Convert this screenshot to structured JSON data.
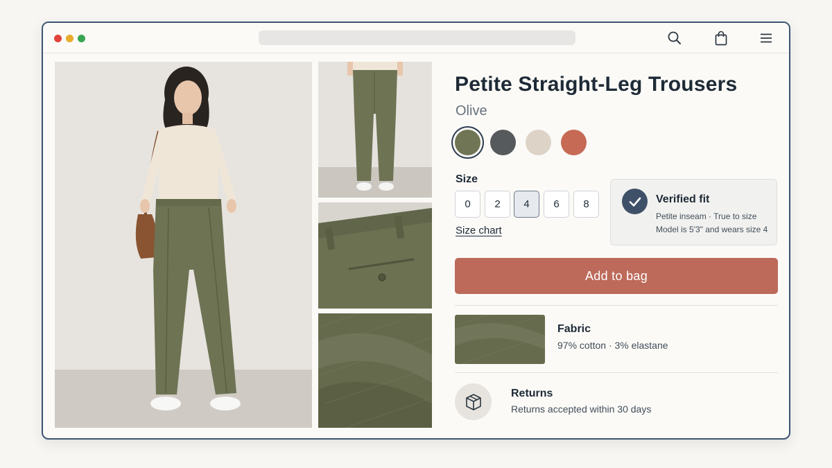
{
  "browser": {
    "controls": [
      "close",
      "minimize",
      "maximize"
    ],
    "icons": [
      "search-icon",
      "shopping-bag-icon",
      "menu-icon"
    ]
  },
  "gallery": {
    "main_image": "Model wearing olive straight-leg trousers and cream sweater",
    "thumbnails": [
      "Back view of trousers",
      "Back pocket detail",
      "Fabric close-up"
    ]
  },
  "product": {
    "title": "Petite Straight-Leg Trousers",
    "color_name": "Olive",
    "swatches": [
      {
        "name": "Olive",
        "hex": "#6f7555",
        "selected": true
      },
      {
        "name": "Charcoal",
        "hex": "#575a5c",
        "selected": false
      },
      {
        "name": "Stone",
        "hex": "#ddd3c7",
        "selected": false
      },
      {
        "name": "Terracotta",
        "hex": "#c66a55",
        "selected": false
      }
    ],
    "size_label": "Size",
    "sizes": [
      "0",
      "2",
      "4",
      "6",
      "8"
    ],
    "selected_size": "4",
    "size_chart_link": "Size chart",
    "add_to_bag": "Add to bag"
  },
  "fit": {
    "title": "Verified fit",
    "line1": "Petite inseam · True to size",
    "line2": "Model is 5'3\" and wears size 4"
  },
  "fabric": {
    "title": "Fabric",
    "composition": "97% cotton · 3% elastane"
  },
  "returns": {
    "title": "Returns",
    "text": "Returns accepted within 30 days"
  },
  "colors": {
    "accent": "#bd6a5b",
    "heading": "#1e2a36",
    "olive": "#6f7555",
    "window_border": "#3d5470"
  }
}
